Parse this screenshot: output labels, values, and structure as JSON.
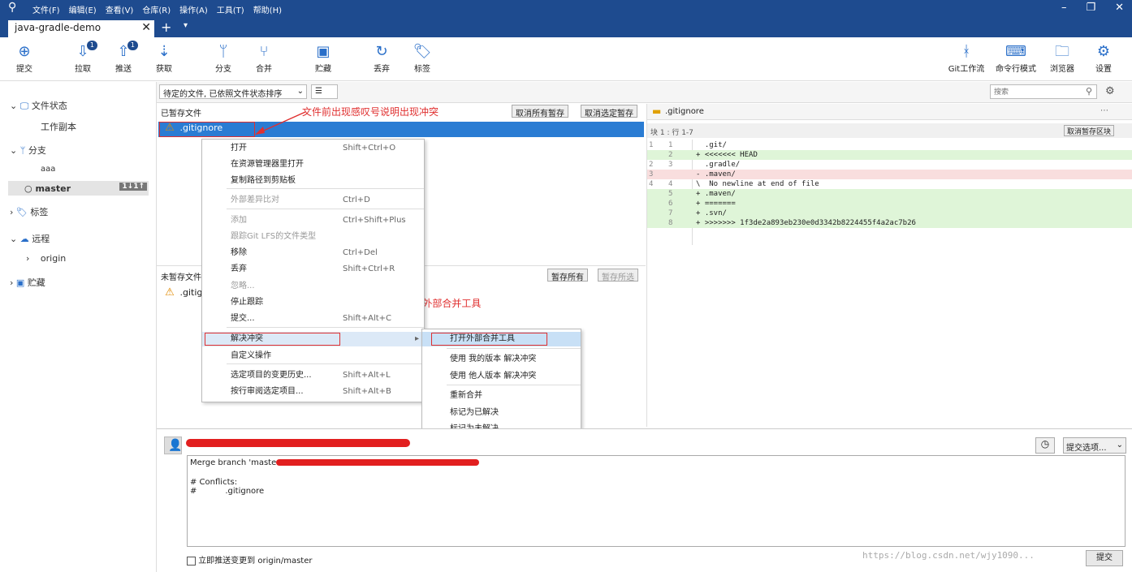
{
  "titlebar": {
    "menu": [
      "文件(F)",
      "编辑(E)",
      "查看(V)",
      "仓库(R)",
      "操作(A)",
      "工具(T)",
      "帮助(H)"
    ],
    "window_controls": [
      "–",
      "❐",
      "✕"
    ]
  },
  "tabs": {
    "active": "java-gradle-demo",
    "close": "✕",
    "add": "+",
    "menu": "▾"
  },
  "toolbar": {
    "commit": "提交",
    "pull": "拉取",
    "pull_badge": "1",
    "push": "推送",
    "push_badge": "1",
    "fetch": "获取",
    "branch": "分支",
    "merge": "合并",
    "stash": "贮藏",
    "discard": "丢弃",
    "tag": "标签",
    "gitflow": "Git工作流",
    "terminal": "命令行模式",
    "explorer": "浏览器",
    "settings": "设置"
  },
  "sidebar": {
    "file_status": "文件状态",
    "working_copy": "工作副本",
    "branches": "分支",
    "branch_aaa": "aaa",
    "branch_master": "master",
    "master_badge": "1↓1↑",
    "tags": "标签",
    "remotes": "远程",
    "remote_origin": "origin",
    "stashes": "贮藏"
  },
  "filter": {
    "sort_combo": "待定的文件, 已依照文件状态排序",
    "view_combo": "☰",
    "search_placeholder": "搜索"
  },
  "staged": {
    "header": "已暂存文件",
    "unstage_all": "取消所有暂存",
    "unstage_selected": "取消选定暂存",
    "file": ".gitignore"
  },
  "unstaged": {
    "header": "未暂存文件",
    "stage_all": "暂存所有",
    "stage_selected": "暂存所选",
    "file": ".gitig"
  },
  "diff": {
    "file": ".gitignore",
    "hunk": "块 1 : 行 1-7",
    "unstage_hunk": "取消暂存区块",
    "lines": [
      {
        "n1": "1",
        "n2": "1",
        "text": "  .git/",
        "type": "ctx"
      },
      {
        "n1": "",
        "n2": "2",
        "text": "+ <<<<<<< HEAD",
        "type": "add"
      },
      {
        "n1": "2",
        "n2": "3",
        "text": "  .gradle/",
        "type": "ctx"
      },
      {
        "n1": "3",
        "n2": "",
        "text": "- .maven/",
        "type": "del"
      },
      {
        "n1": "4",
        "n2": "4",
        "text": "\\  No newline at end of file",
        "type": "ctx"
      },
      {
        "n1": "",
        "n2": "5",
        "text": "+ .maven/",
        "type": "add"
      },
      {
        "n1": "",
        "n2": "6",
        "text": "+ =======",
        "type": "add"
      },
      {
        "n1": "",
        "n2": "7",
        "text": "+ .svn/",
        "type": "add"
      },
      {
        "n1": "",
        "n2": "8",
        "text": "+ >>>>>>> 1f3de2a893eb230e0d3342b8224455f4a2ac7b26",
        "type": "add"
      }
    ]
  },
  "context_menu": {
    "items": [
      {
        "label": "打开",
        "shortcut": "Shift+Ctrl+O",
        "disabled": false
      },
      {
        "label": "在资源管理器里打开",
        "shortcut": "",
        "disabled": false
      },
      {
        "label": "复制路径到剪贴板",
        "shortcut": "",
        "disabled": false
      },
      {
        "label": "外部差异比对",
        "shortcut": "Ctrl+D",
        "disabled": true
      },
      {
        "label": "添加",
        "shortcut": "Ctrl+Shift+Plus",
        "disabled": true
      },
      {
        "label": "跟踪Git LFS的文件类型",
        "shortcut": "",
        "disabled": true
      },
      {
        "label": "移除",
        "shortcut": "Ctrl+Del",
        "disabled": false
      },
      {
        "label": "丢弃",
        "shortcut": "Shift+Ctrl+R",
        "disabled": false
      },
      {
        "label": "忽略...",
        "shortcut": "",
        "disabled": true
      },
      {
        "label": "停止跟踪",
        "shortcut": "",
        "disabled": false
      },
      {
        "label": "提交...",
        "shortcut": "Shift+Alt+C",
        "disabled": false
      },
      {
        "label": "解决冲突",
        "shortcut": "▸",
        "disabled": false
      },
      {
        "label": "自定义操作",
        "shortcut": "",
        "disabled": false
      },
      {
        "label": "选定项目的变更历史...",
        "shortcut": "Shift+Alt+L",
        "disabled": false
      },
      {
        "label": "按行审阅选定项目...",
        "shortcut": "Shift+Alt+B",
        "disabled": false
      }
    ],
    "submenu": [
      "打开外部合并工具",
      "使用 我的版本 解决冲突",
      "使用 他人版本 解决冲突",
      "重新合并",
      "标记为已解决",
      "标记为未解决"
    ]
  },
  "annotations": {
    "top": "文件前出现感叹号说明出现冲突",
    "middle": "右键点击解决冲突->打开外部合并工具"
  },
  "commit": {
    "message_lines": [
      "Merge branch 'master",
      "",
      "# Conflicts:",
      "#           .gitignore"
    ],
    "push_checkbox": "立即推送变更到 origin/master",
    "options": "提交选项...",
    "submit": "提交",
    "watermark": "https://blog.csdn.net/wjy1090..."
  }
}
